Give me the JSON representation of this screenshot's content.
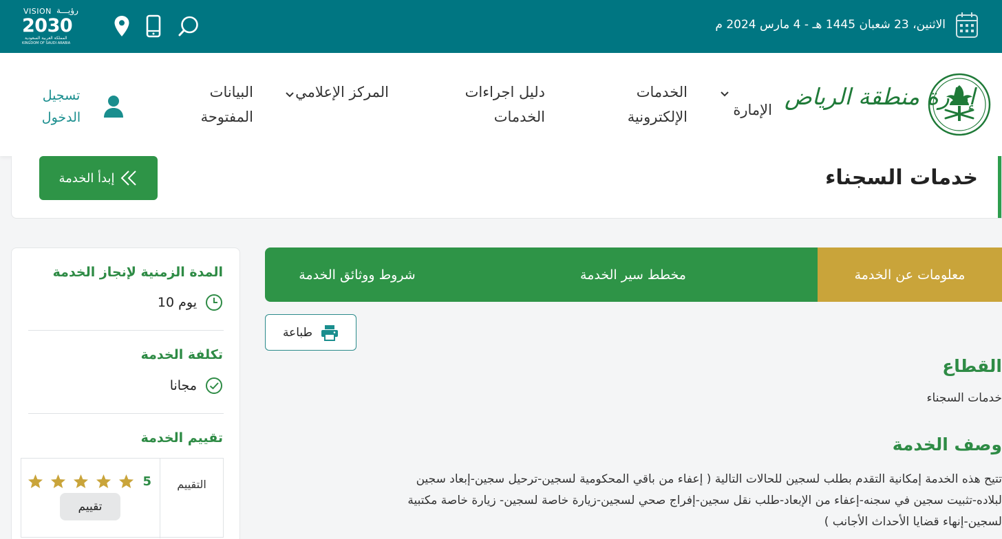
{
  "topbar": {
    "date": "الاثنين، 23 شعبان 1445 هـ - 4 مارس 2024 م",
    "vision": {
      "word": "VISION",
      "arabic_word": "رؤيـــة",
      "year": "2030",
      "country_ar": "المملكة العربية السعودية",
      "country_en": "KINGDOM OF SAUDI ARABIA"
    },
    "icons": [
      "location-icon",
      "mobile-icon",
      "search-icon",
      "calendar-icon"
    ]
  },
  "header": {
    "logo_text": "إمارة منطقة الرياض",
    "nav": {
      "emirate": "الإمارة",
      "eservices_1": "الخدمات",
      "eservices_2": "الإلكترونية",
      "guide_1": "دليل اجراءات",
      "guide_2": "الخدمات",
      "media": "المركز الإعلامي",
      "opendata_1": "البيانات",
      "opendata_2": "المفتوحة"
    },
    "login_1": "تسجيل",
    "login_2": "الدخول"
  },
  "page": {
    "title": "خدمات السجناء",
    "start_button": "إبدأ الخدمة"
  },
  "sidebar": {
    "duration_title": "المدة الزمنية لإنجاز الخدمة",
    "duration_value": "10 يوم",
    "cost_title": "تكلفة الخدمة",
    "cost_value": "مجانا",
    "rating_title": "تقييم الخدمة",
    "rating_label": "التقييم",
    "rating_value": "5",
    "rating_stars": 5,
    "rate_button": "تقييم"
  },
  "tabs": [
    {
      "label": "معلومات عن الخدمة",
      "active": true
    },
    {
      "label": "مخطط سير الخدمة",
      "active": false
    },
    {
      "label": "شروط ووثائق الخدمة",
      "active": false
    }
  ],
  "print_label": "طباعة",
  "content": {
    "sector_title": "القطاع",
    "sector_value": "خدمات السجناء",
    "desc_title": "وصف الخدمة",
    "desc_line1": "تتيح هذه الخدمة إمكانية التقدم بطلب لسجين للحالات التالية ( إعفاء من باقي المحكومية لسجين-ترحيل سجين-إبعاد سجين",
    "desc_line2": "لبلاده-تثبيت سجين في سجنه-إعفاء من الإبعاد-طلب نقل سجين-إفراج صحي لسجين-زيارة خاصة لسجين- زيارة خاصة مكتبية",
    "desc_line3": "لسجين-إنهاء قضايا الأحداث الأجانب )"
  },
  "colors": {
    "topbar": "#007682",
    "green": "#2e9447",
    "gold": "#c9a43a",
    "teal_text": "#1a8e8e"
  }
}
